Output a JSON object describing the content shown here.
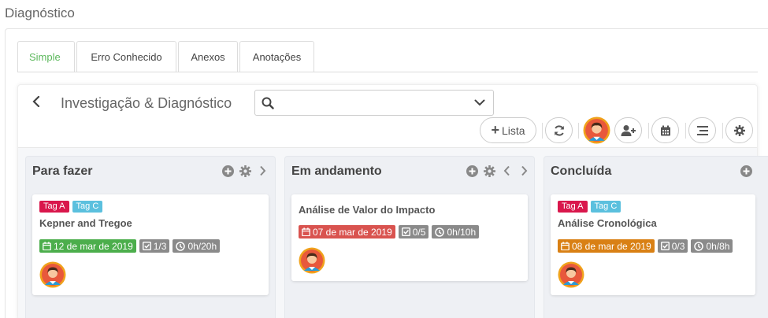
{
  "page": {
    "title": "Diagnóstico"
  },
  "tabs": [
    {
      "label": "Simple",
      "active": true
    },
    {
      "label": "Erro Conhecido"
    },
    {
      "label": "Anexos"
    },
    {
      "label": "Anotações"
    }
  ],
  "board": {
    "title": "Investigação & Diagnóstico",
    "search": {
      "value": "",
      "placeholder": ""
    },
    "lista_label": "Lista",
    "icons": [
      "back-icon",
      "search-icon",
      "chevron-down-icon",
      "refresh-icon",
      "add-user-icon",
      "calendar-icon",
      "align-icon",
      "gear-icon"
    ]
  },
  "colors": {
    "accent_green": "#5cb85c",
    "tag_a": "#d9174c",
    "tag_c": "#5bc0de",
    "due_green": "#4cae4c",
    "due_red": "#d9534f",
    "due_orange": "#d98014",
    "badge_gray": "#8a8a8a"
  },
  "columns": [
    {
      "title": "Para fazer",
      "cards": [
        {
          "tags": [
            "Tag A",
            "Tag C"
          ],
          "title": "Kepner and Tregoe",
          "due": "12 de mar de 2019",
          "due_color": "#4cae4c",
          "checklist": "1/3",
          "time": "0h/20h"
        }
      ]
    },
    {
      "title": "Em andamento",
      "cards": [
        {
          "tags": [],
          "title": "Análise de Valor do Impacto",
          "due": "07 de mar de 2019",
          "due_color": "#d9534f",
          "checklist": "0/5",
          "time": "0h/10h"
        }
      ]
    },
    {
      "title": "Concluída",
      "cards": [
        {
          "tags": [
            "Tag A",
            "Tag C"
          ],
          "title": "Análise Cronológica",
          "due": "08 de mar de 2019",
          "due_color": "#d98014",
          "checklist": "0/3",
          "time": "0h/8h"
        }
      ]
    }
  ]
}
